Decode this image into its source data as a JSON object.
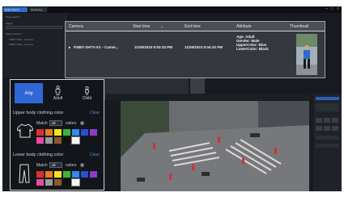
{
  "window": {
    "tab_active": "Deep Search",
    "tab_other": "Monitoring",
    "minimize_glyph": "–",
    "maximize_glyph": "□",
    "close_glyph": "×"
  },
  "sidebar": {
    "title": "Deep Search",
    "object_label": "Object",
    "select_devices_label": "Select devices",
    "device_1": "P3807-PVE – Camera",
    "device_2": "P3807-PVE – Camera"
  },
  "results_table": {
    "columns": [
      "Camera",
      "Start time",
      "End time",
      "Attribute",
      "Thumbnail"
    ],
    "sort_indicator": "⌄",
    "rows": [
      {
        "camera": "P3807-ZHTV-V3 – Camer...",
        "start_time": "11/26/2023 5:03:33 PM",
        "end_time": "11/26/2023 5:04:42 PM",
        "attribute_lines": [
          "Age: Adult",
          "Gender: Male",
          "UpperColor: Blue",
          "LowerColor: Black"
        ]
      }
    ]
  },
  "filter": {
    "age_options": [
      "Any",
      "Adult",
      "Child"
    ],
    "selected_age": "Any",
    "upper_title": "Upper body clothing color",
    "lower_title": "Lower body clothing color",
    "clear_label": "Clear",
    "match_label": "Match",
    "match_value": "all",
    "colors_label": "colors",
    "info_glyph": "i",
    "upper_swatches": [
      "#d8322b",
      "#f0781e",
      "#f5e11e",
      "#3cb43c",
      "#2d8cf0",
      "#2850d2",
      "#8c3cc8",
      "#e84aa0",
      "#9a9a9a",
      "#8a5a2c",
      "#111111",
      "#f4f4f4"
    ],
    "lower_swatches": [
      "#d8322b",
      "#f0781e",
      "#f5e11e",
      "#3cb43c",
      "#2d8cf0",
      "#2850d2",
      "#8c3cc8",
      "#e84aa0",
      "#9a9a9a",
      "#8a5a2c",
      "#111111",
      "#f4f4f4"
    ]
  },
  "colors": {
    "accent": "#3067d8",
    "link": "#4a8fe8",
    "app_bg": "#171a1e"
  }
}
